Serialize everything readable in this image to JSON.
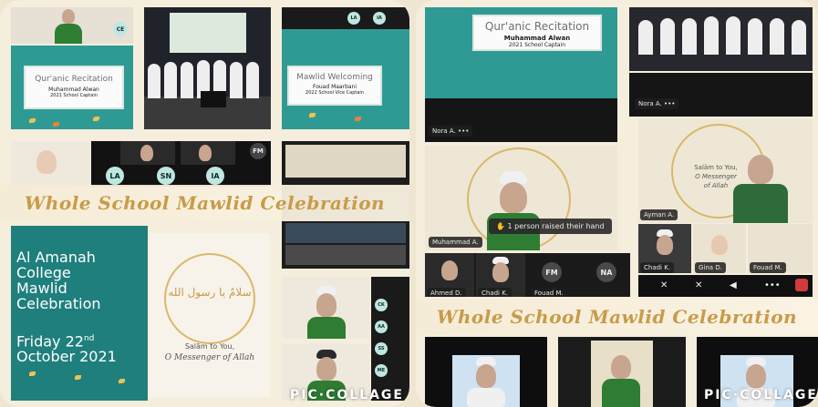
{
  "left": {
    "banner": "Whole School Mawlid Celebration",
    "recitation": {
      "title": "Qur'anic Recitation",
      "name": "Muhammad Alwan",
      "role": "2021 School Captain"
    },
    "welcoming": {
      "title": "Mawlid Welcoming",
      "name": "Fouad Maarbani",
      "role": "2022 School Vice Captain"
    },
    "event": {
      "line1": "Al Amanah",
      "line2": "College",
      "line3": "Mawlid",
      "line4": "Celebration",
      "date_day": "Friday 22",
      "date_suffix": "nd",
      "date_rest": "October 2021"
    },
    "poster": {
      "arabic": "سلامٌ يا رسول الله",
      "english1": "Salām to You,",
      "english2": "O Messenger of Allah"
    },
    "initials": {
      "ce": "CE",
      "la_top": "LA",
      "ia_top": "IA",
      "fm": "FM",
      "la": "LA",
      "sn": "SN",
      "ia": "IA",
      "ck": "CK",
      "aa": "AA",
      "ss": "SS",
      "me": "ME"
    },
    "watermark": "PIC·COLLAGE"
  },
  "right": {
    "banner": "Whole School Mawlid Celebration",
    "recitation": {
      "title": "Qur'anic Recitation",
      "name": "Muhammad Alwan",
      "role": "2021 School Captain"
    },
    "names": {
      "nora1": "Nora A.",
      "nora2": "Nora A.",
      "muhammad": "Muhammad A.",
      "ayman": "Ayman A.",
      "chadi": "Chadi K.",
      "gina": "Gina D.",
      "fouad": "Fouad M.",
      "ahmed": "Ahmed D.",
      "chadi2": "Chadi K.",
      "fouad2": "Fouad M."
    },
    "raise_hand": "1 person raised their hand",
    "poster": {
      "english1": "Salām to You,",
      "english2": "O Messenger",
      "english3": "of Allah"
    },
    "initials": {
      "fm": "FM",
      "na": "NA"
    },
    "watermark": "PIC·COLLAGE"
  }
}
